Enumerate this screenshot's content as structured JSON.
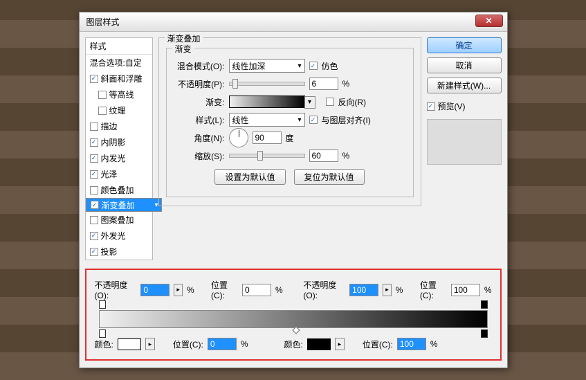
{
  "title": "图层样式",
  "styles": {
    "header": "样式",
    "blend": "混合选项:自定",
    "items": [
      {
        "label": "斜面和浮雕",
        "checked": true,
        "sub": false
      },
      {
        "label": "等高线",
        "checked": false,
        "sub": true
      },
      {
        "label": "纹理",
        "checked": false,
        "sub": true
      },
      {
        "label": "描边",
        "checked": false,
        "sub": false
      },
      {
        "label": "内阴影",
        "checked": true,
        "sub": false
      },
      {
        "label": "内发光",
        "checked": true,
        "sub": false
      },
      {
        "label": "光泽",
        "checked": true,
        "sub": false
      },
      {
        "label": "颜色叠加",
        "checked": false,
        "sub": false
      },
      {
        "label": "渐变叠加",
        "checked": true,
        "sub": false,
        "selected": true
      },
      {
        "label": "图案叠加",
        "checked": false,
        "sub": false
      },
      {
        "label": "外发光",
        "checked": true,
        "sub": false
      },
      {
        "label": "投影",
        "checked": true,
        "sub": false
      }
    ]
  },
  "panel": {
    "group": "渐变叠加",
    "sub": "渐变",
    "blend_label": "混合模式(O):",
    "blend_value": "线性加深",
    "dither": "仿色",
    "opacity_label": "不透明度(P):",
    "opacity": "6",
    "pct": "%",
    "grad_label": "渐变:",
    "reverse": "反向(R)",
    "style_label": "样式(L):",
    "style_value": "线性",
    "align": "与图层对齐(I)",
    "angle_label": "角度(N):",
    "angle": "90",
    "deg": "度",
    "scale_label": "缩放(S):",
    "scale": "60",
    "btn_default": "设置为默认值",
    "btn_reset": "复位为默认值"
  },
  "right": {
    "ok": "确定",
    "cancel": "取消",
    "newstyle": "新建样式(W)...",
    "preview": "预览(V)"
  },
  "editor": {
    "op_l": "不透明度(O):",
    "op1": "0",
    "loc_l": "位置(C):",
    "loc1": "0",
    "op2": "100",
    "loc2": "100",
    "color_l": "颜色:",
    "loc3": "0",
    "loc4": "100",
    "pct": "%",
    "color1": "#ffffff",
    "color2": "#000000"
  }
}
